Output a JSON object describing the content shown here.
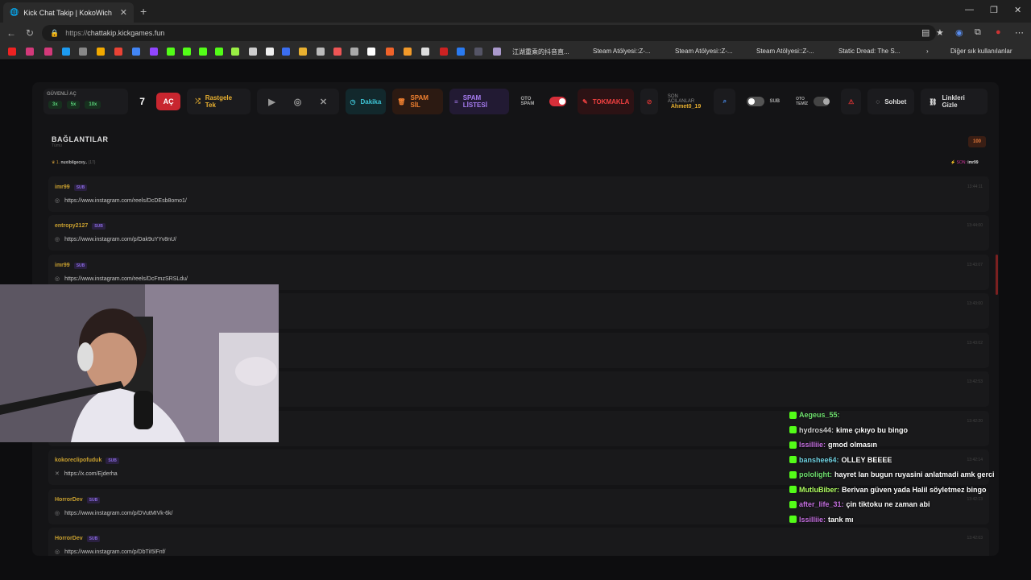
{
  "browser": {
    "tab_title": "Kick Chat Takip | KokoWich",
    "url_proto": "https://",
    "url_host": "chattakip.kickgames.fun",
    "bookmarks": [
      "江湖重乘的抖音直...",
      "Steam Atölyesi::Z-...",
      "Steam Atölyesi::Z-...",
      "Steam Atölyesi::Z-...",
      "Static Dread: The S..."
    ],
    "bookmarks_folder": "Diğer sık kullanılanlar"
  },
  "toolbar": {
    "guvenli_ac_label": "GÜVENLİ AÇ",
    "multipliers": [
      "3x",
      "5x",
      "10x"
    ],
    "count": "7",
    "ac_label": "AÇ",
    "random_label": "Rastgele Tek",
    "dakika_label": "Dakika",
    "spam_sil_label": "SPAM SİL",
    "spam_listesi_label": "SPAM LİSTESİ",
    "oto_spam_label": "OTO SPAM",
    "tokmakla_label": "TOKMAKLA",
    "son_acilanlar_label": "SON AÇILANLAR",
    "son_acilanlar_user": "Ahmet0_19",
    "sub_label": "SUB",
    "oto_temiz_label": "OTO TEMİZ",
    "sohbet_label": "Sohbet",
    "linkleri_gizle_label": "Linkleri Gizle"
  },
  "colors": {
    "accent_red": "#c8262f",
    "user_gold": "#c9a02f",
    "sub_purple": "#8a6ae0",
    "kick_green": "#53fc18"
  },
  "section": {
    "title": "BAĞLANTILAR",
    "subtitle": "Tümü",
    "badge": "100",
    "top_user_prefix": "1.",
    "top_user": "nuxibilgecey..",
    "top_user_count": "(17)",
    "son_label": "SON:",
    "son_user": "imr99"
  },
  "rows": [
    {
      "user": "imr99",
      "sub": "SUB",
      "link": "https://www.instagram.com/reels/DcDEsb8omo1/",
      "icon": "instagram-icon",
      "time": "13:44:11"
    },
    {
      "user": "entropy2127",
      "sub": "SUB",
      "link": "https://www.instagram.com/p/Dak9uYYv8nU/",
      "icon": "instagram-icon",
      "time": "13:44:00"
    },
    {
      "user": "imr99",
      "sub": "SUB",
      "link": "https://www.instagram.com/reels/DcFmzSRSLdu/",
      "icon": "instagram-icon",
      "time": "13:43:07"
    },
    {
      "user": "",
      "sub": "",
      "link": "",
      "icon": "",
      "time": "13:43:00"
    },
    {
      "user": "",
      "sub": "",
      "link": "",
      "icon": "",
      "time": "13:43:02"
    },
    {
      "user": "",
      "sub": "",
      "link": "",
      "icon": "",
      "time": "13:42:53"
    },
    {
      "user": "",
      "sub": "",
      "link": "",
      "icon": "",
      "time": "13:42:20"
    },
    {
      "user": "kokoreclipofuduk",
      "sub": "SUB",
      "link": "https://x.com/Ejderha",
      "icon": "x-icon",
      "time": "13:42:14"
    },
    {
      "user": "HorrorDev",
      "sub": "SUB",
      "link": "https://www.instagram.com/p/DVutMIVk-6k/",
      "icon": "instagram-icon",
      "time": "13:42:13"
    },
    {
      "user": "HorrorDev",
      "sub": "SUB",
      "link": "https://www.instagram.com/p/DbTiI5lFnf/",
      "icon": "instagram-icon",
      "time": "13:42:03"
    }
  ],
  "chat": [
    {
      "user": "Aegeus_55:",
      "msg": "",
      "color": "#6fe06f"
    },
    {
      "user": "hydros44:",
      "msg": "kime çıkıyo bu bingo",
      "color": "#cfcfcf"
    },
    {
      "user": "lssilliie:",
      "msg": "gmod olmasın",
      "color": "#c56fe0"
    },
    {
      "user": "banshee64:",
      "msg": "OLLEY BEEEE",
      "color": "#6fd0e0"
    },
    {
      "user": "pololight:",
      "msg": "hayret lan bugun ruyasini anlatmadi amk gerci",
      "color": "#6fe06f"
    },
    {
      "user": "MutluBiber:",
      "msg": "Berivan güven yada Halil söyletmez bingo",
      "color": "#b0ff60"
    },
    {
      "user": "after_life_31:",
      "msg": "çin tiktoku ne zaman abi",
      "color": "#c56fe0"
    },
    {
      "user": "lssilliie:",
      "msg": "tank mı",
      "color": "#c56fe0"
    }
  ]
}
